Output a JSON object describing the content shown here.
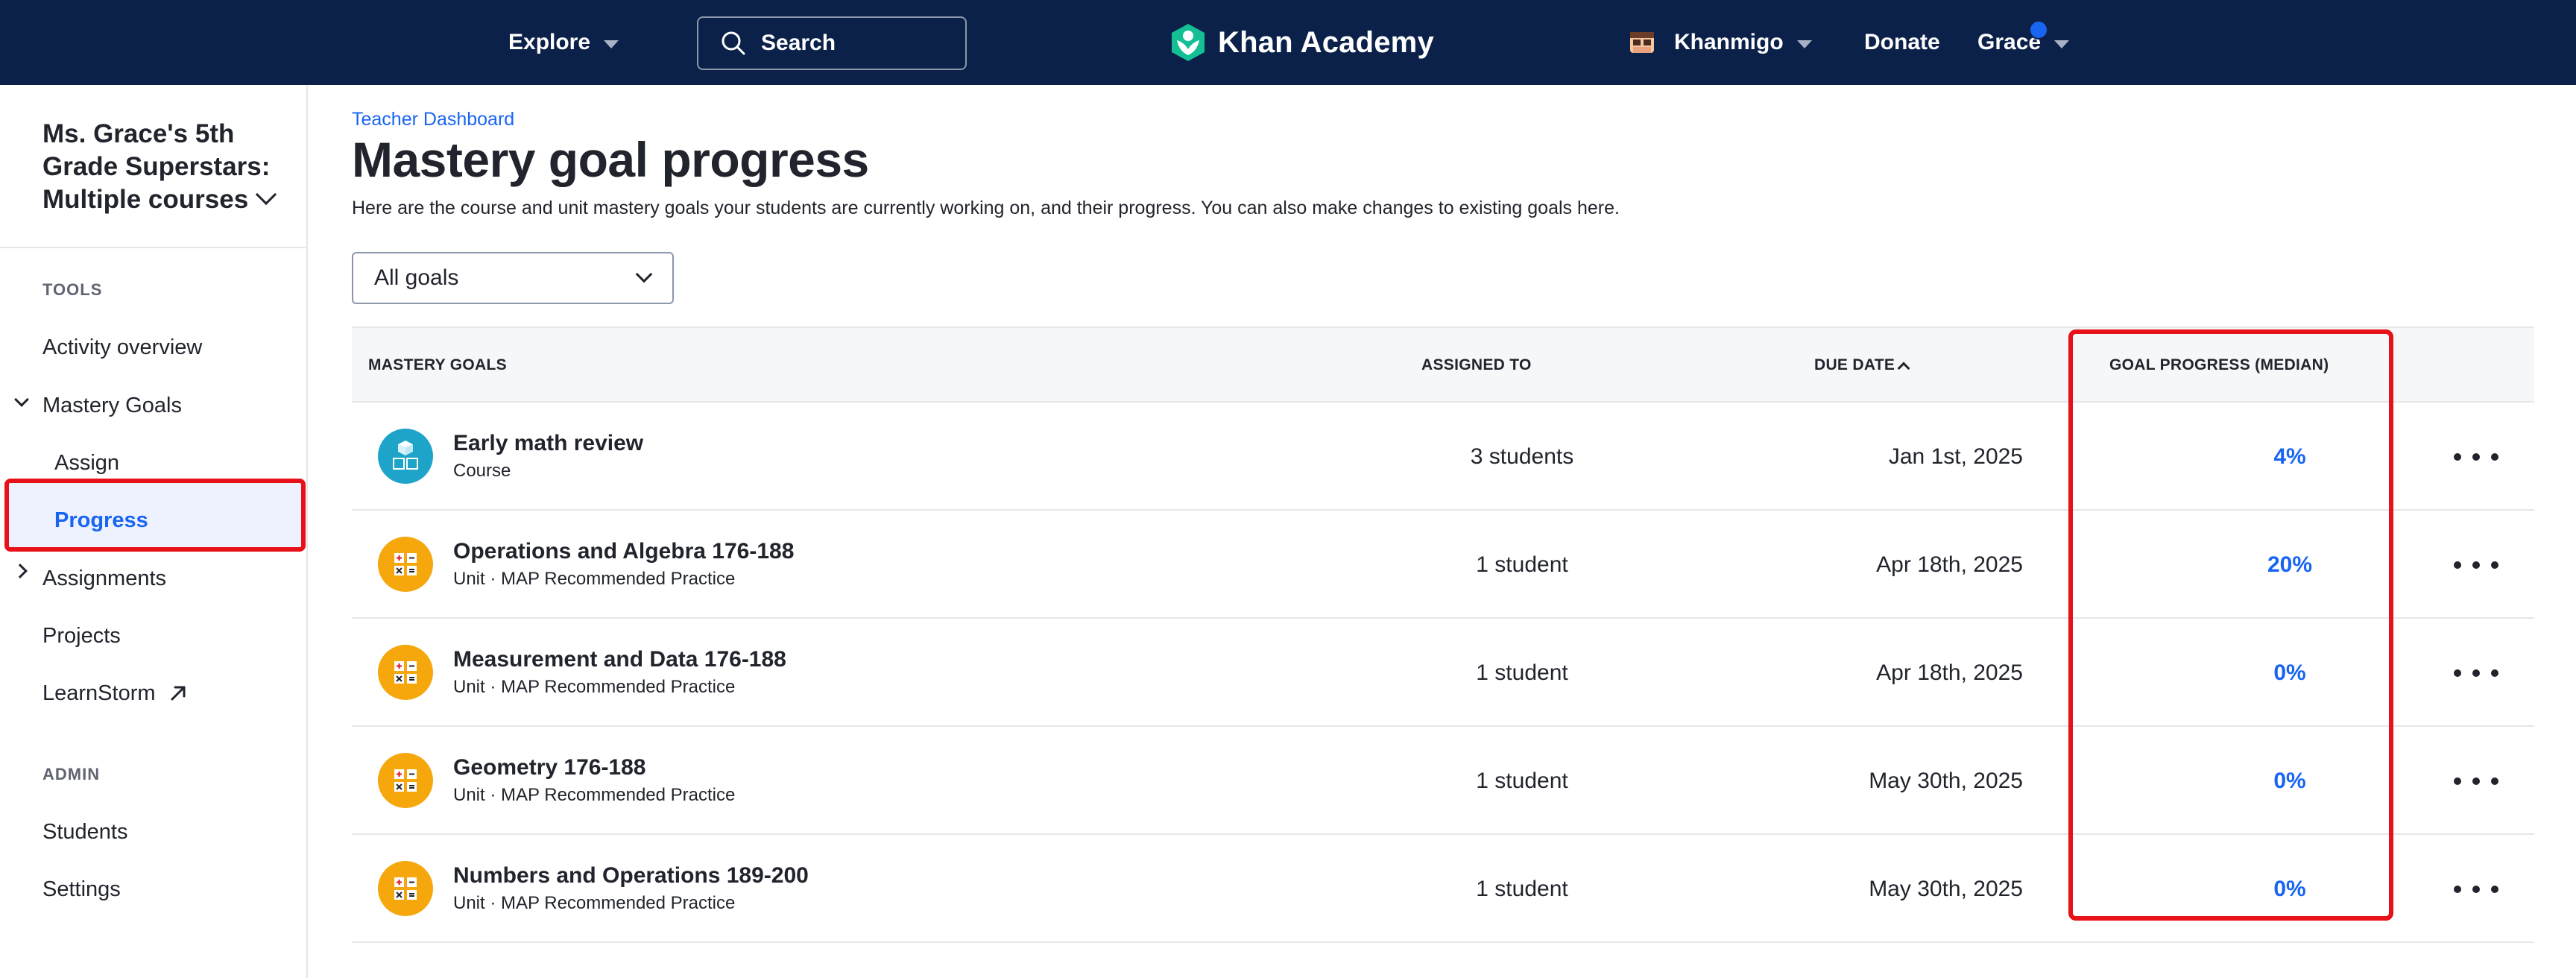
{
  "topnav": {
    "explore_label": "Explore",
    "search_label": "Search",
    "logo_text": "Khan Academy",
    "khanmigo_label": "Khanmigo",
    "donate_label": "Donate",
    "user_label": "Grace",
    "brand_color": "#0b2149",
    "logo_color": "#14bf96"
  },
  "sidebar": {
    "class_name": "Ms. Grace's 5th Grade Superstars: Multiple courses",
    "tools_heading": "TOOLS",
    "activity_overview": "Activity overview",
    "mastery_goals": "Mastery Goals",
    "assign": "Assign",
    "progress": "Progress",
    "assignments": "Assignments",
    "projects": "Projects",
    "learnstorm": "LearnStorm",
    "admin_heading": "ADMIN",
    "students": "Students",
    "settings": "Settings"
  },
  "main": {
    "breadcrumb": "Teacher Dashboard",
    "title": "Mastery goal progress",
    "description": "Here are the course and unit mastery goals your students are currently working on, and their progress. You can also make changes to existing goals here.",
    "filter_selected": "All goals"
  },
  "table": {
    "headers": {
      "goals": "MASTERY GOALS",
      "assigned": "ASSIGNED TO",
      "due": "DUE DATE",
      "progress": "GOAL PROGRESS (MEDIAN)"
    },
    "rows": [
      {
        "title": "Early math review",
        "subtitle": "Course",
        "assigned": "3 students",
        "due": "Jan 1st, 2025",
        "progress": "4%"
      },
      {
        "title": "Operations and Algebra 176-188",
        "subtitle": "Unit · MAP Recommended Practice",
        "assigned": "1 student",
        "due": "Apr 18th, 2025",
        "progress": "20%"
      },
      {
        "title": "Measurement and Data 176-188",
        "subtitle": "Unit · MAP Recommended Practice",
        "assigned": "1 student",
        "due": "Apr 18th, 2025",
        "progress": "0%"
      },
      {
        "title": "Geometry 176-188",
        "subtitle": "Unit · MAP Recommended Practice",
        "assigned": "1 student",
        "due": "May 30th, 2025",
        "progress": "0%"
      },
      {
        "title": "Numbers and Operations 189-200",
        "subtitle": "Unit · MAP Recommended Practice",
        "assigned": "1 student",
        "due": "May 30th, 2025",
        "progress": "0%"
      }
    ]
  },
  "colors": {
    "link_blue": "#1865f2",
    "highlight_red": "#e7111a",
    "course_icon": "#1ea4c8",
    "unit_icon": "#f5a70c"
  }
}
